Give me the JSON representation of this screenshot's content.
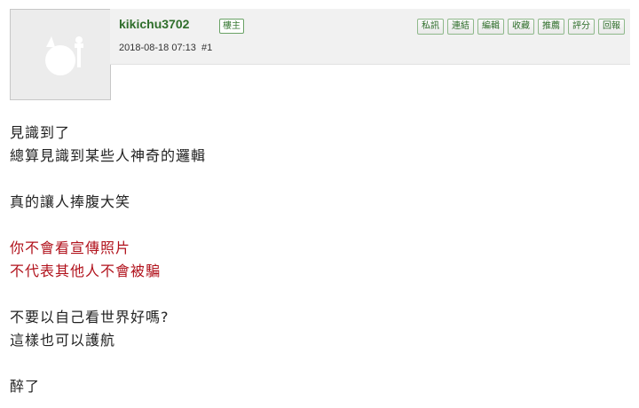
{
  "post": {
    "username": "kikichu3702",
    "op_badge": "樓主",
    "meta": "2018-08-18 07:13  #1",
    "avatar_icon": "default-avatar-icon"
  },
  "actions": [
    {
      "label": "私訊"
    },
    {
      "label": "連結"
    },
    {
      "label": "編輯"
    },
    {
      "label": "收藏"
    },
    {
      "label": "推薦"
    },
    {
      "label": "評分"
    },
    {
      "label": "回報"
    }
  ],
  "colors": {
    "username": "#2f6e2b",
    "highlight": "#b1121c",
    "header_bg": "#f1f1f1"
  },
  "content": {
    "lines": [
      "見識到了",
      "總算見識到某些人神奇的邏輯",
      "真的讓人捧腹大笑",
      "你不會看宣傳照片",
      "不代表其他人不會被騙",
      "不要以自己看世界好嗎?",
      "這樣也可以護航",
      "醉了"
    ]
  }
}
